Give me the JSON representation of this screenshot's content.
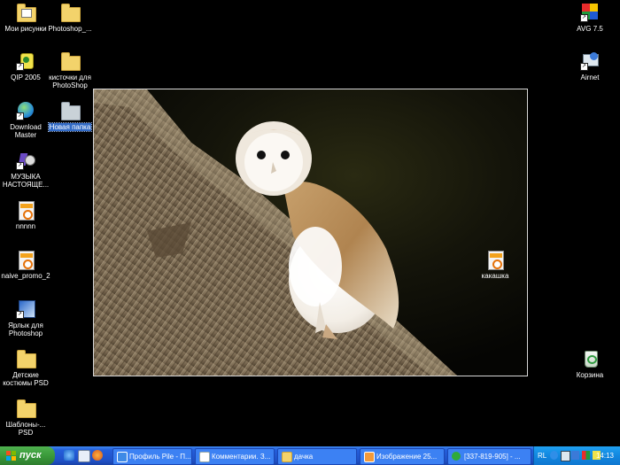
{
  "desktop": {
    "icons": [
      {
        "label": "Мои рисунки",
        "icon": "my-pictures-icon"
      },
      {
        "label": "Photoshop_...",
        "icon": "folder-icon"
      },
      {
        "label": "AVG 7.5",
        "icon": "avg-icon"
      },
      {
        "label": "QIP 2005",
        "icon": "qip-icon"
      },
      {
        "label": "кисточки для PhotoShop",
        "icon": "folder-icon"
      },
      {
        "label": "Airnet",
        "icon": "airnet-icon"
      },
      {
        "label": "Download Master",
        "icon": "download-master-icon"
      },
      {
        "label": "Новая папка",
        "icon": "folder-icon"
      },
      {
        "label": "МУЗЫКА НАСТОЯЩЕ...",
        "icon": "music-icon"
      },
      {
        "label": "nnnnn",
        "icon": "image-file-icon"
      },
      {
        "label": "naive_promo_2",
        "icon": "image-file-icon"
      },
      {
        "label": "какашка",
        "icon": "image-file-icon"
      },
      {
        "label": "Ярлык для Photoshop",
        "icon": "photoshop-shortcut-icon"
      },
      {
        "label": "Детские костюмы PSD",
        "icon": "folder-icon"
      },
      {
        "label": "Корзина",
        "icon": "recycle-bin-icon"
      },
      {
        "label": "Шаблоны-... PSD",
        "icon": "folder-icon"
      }
    ]
  },
  "wallpaper": {
    "subject": "barn owl on thatched roof"
  },
  "taskbar": {
    "start_label": "пуск",
    "quick_launch": [
      "ie-icon",
      "media-icon",
      "firefox-icon"
    ],
    "tasks": [
      {
        "label": "Профиль Pile - П...",
        "icon": "ie-window-icon"
      },
      {
        "label": "Комментарии. З...",
        "icon": "document-icon"
      },
      {
        "label": "дачка",
        "icon": "folder-icon"
      },
      {
        "label": "Изображение 25...",
        "icon": "image-viewer-icon"
      },
      {
        "label": "[337-819-905] - ...",
        "icon": "icq-icon"
      }
    ],
    "tray": {
      "language": "RL",
      "clock": "14:13"
    }
  },
  "colors": {
    "taskbar": "#245edb",
    "start": "#3a9a3a",
    "selection": "#316ac5"
  }
}
